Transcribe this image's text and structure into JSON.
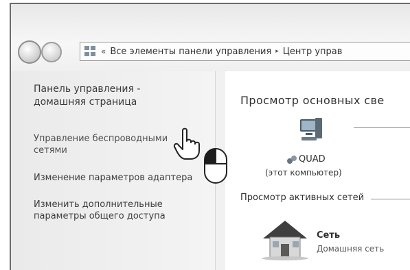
{
  "window": {
    "address_bar": {
      "chevron": "«",
      "crumbs": [
        "Все элементы панели управления",
        "Центр управ"
      ],
      "separator": "▸"
    }
  },
  "sidebar": {
    "home_title": "Панель управления - домашняя страница",
    "links": [
      "Управление беспроводными сетями",
      "Изменение параметров адаптера",
      "Изменить дополнительные параметры общего доступа"
    ]
  },
  "main": {
    "title": "Просмотр основных све",
    "computer": {
      "name": "QUAD",
      "subtitle": "(этот компьютер)"
    },
    "active_networks_title": "Просмотр активных сетей",
    "network": {
      "name": "Сеть",
      "type": "Домашняя сеть"
    }
  },
  "icons": {
    "back": "back-arrow-icon",
    "forward": "forward-arrow-icon",
    "control_panel": "control-panel-icon",
    "computer": "computer-icon",
    "house": "house-icon",
    "hand_cursor": "hand-cursor-icon",
    "mouse": "mouse-left-click-icon"
  }
}
